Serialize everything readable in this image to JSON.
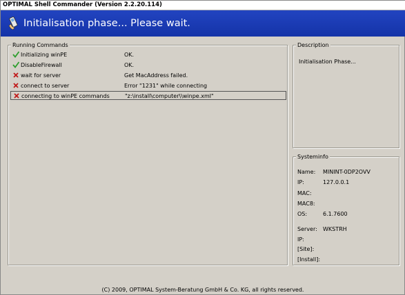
{
  "window": {
    "title": "OPTIMAL Shell Commander (Version 2.2.20.114)"
  },
  "banner": {
    "text": "Initialisation phase... Please wait.",
    "icon": "phone-icon"
  },
  "running_commands": {
    "legend": "Running Commands",
    "rows": [
      {
        "icon": "check-icon",
        "name": "Initializing winPE",
        "status": "OK."
      },
      {
        "icon": "check-icon",
        "name": "DisableFirewall",
        "status": "OK."
      },
      {
        "icon": "error-x-icon",
        "name": "wait for server",
        "status": "Get MacAddress failed."
      },
      {
        "icon": "error-x-icon",
        "name": "connect to server",
        "status": "Error \"1231\" while connecting"
      },
      {
        "icon": "error-x-icon",
        "name": "connecting to winPE commands",
        "status": "\"z:\\install\\computer\\\\winpe.xml\""
      }
    ],
    "selected_index": 4
  },
  "description": {
    "legend": "Description",
    "text": "Initialisation Phase..."
  },
  "systeminfo": {
    "legend": "Systeminfo",
    "name_label": "Name:",
    "name_value": "MININT-0DP2OVV",
    "ip_label": "IP:",
    "ip_value": "127.0.0.1",
    "mac_label": "MAC:",
    "mac_value": "",
    "mac8_label": "MAC8:",
    "mac8_value": "",
    "os_label": "OS:",
    "os_value": "6.1.7600",
    "server_label": "Server:",
    "server_value": "WKSTRH",
    "server_ip_label": "IP:",
    "server_ip_value": "",
    "site_label": "[Site]:",
    "site_value": "",
    "install_label": "[Install]:",
    "install_value": ""
  },
  "footer": {
    "copyright": "(C) 2009, OPTIMAL System-Beratung GmbH & Co. KG, all rights reserved."
  },
  "colors": {
    "banner": "#1a3bb5",
    "check": "#2e9e2e",
    "error": "#c01818"
  }
}
